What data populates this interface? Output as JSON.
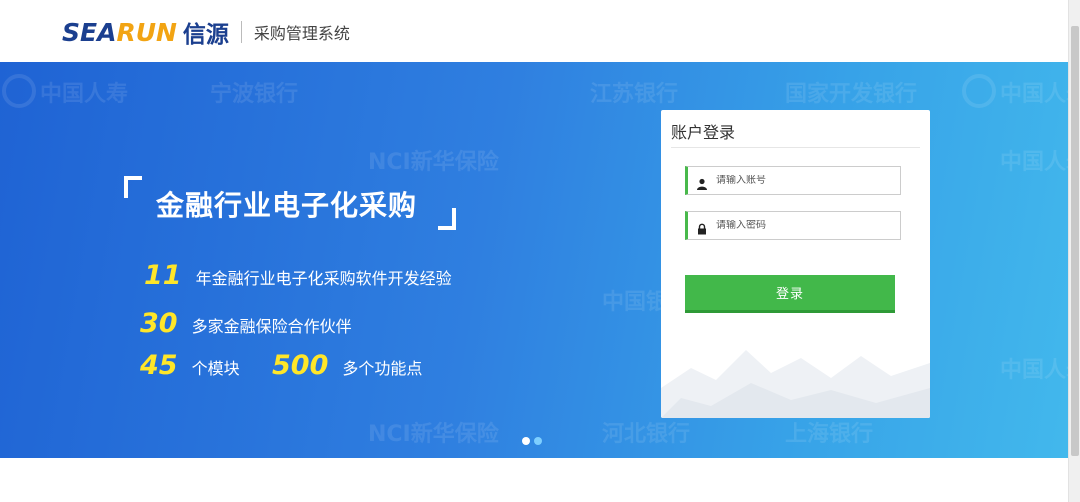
{
  "header": {
    "logo_part1": "SEA",
    "logo_part2": "RUN",
    "logo_cn": "信源",
    "system_name": "采购管理系统"
  },
  "banner": {
    "slogan": "金融行业电子化采购",
    "stats": [
      {
        "num": "11",
        "text": "年金融行业电子化采购软件开发经验"
      },
      {
        "num": "30",
        "text": "多家金融保险合作伙伴"
      },
      {
        "num": "45",
        "text": "个模块"
      },
      {
        "num": "500",
        "text": "多个功能点"
      }
    ],
    "watermarks": [
      "中国人寿",
      "宁波银行",
      "国家开发银行",
      "中国人寿",
      "NCI新华保险",
      "中国人寿",
      "中国银行",
      "河北银行",
      "上海银行",
      "中国人寿",
      "NCI新华保险",
      "江苏银行"
    ]
  },
  "login": {
    "title": "账户登录",
    "username_placeholder": "请输入账号",
    "password_placeholder": "请输入密码",
    "submit_label": "登录"
  },
  "colors": {
    "brand_blue": "#1b3f8f",
    "brand_orange": "#f2a413",
    "accent_green": "#42b84a",
    "stat_yellow": "#ffe629"
  }
}
